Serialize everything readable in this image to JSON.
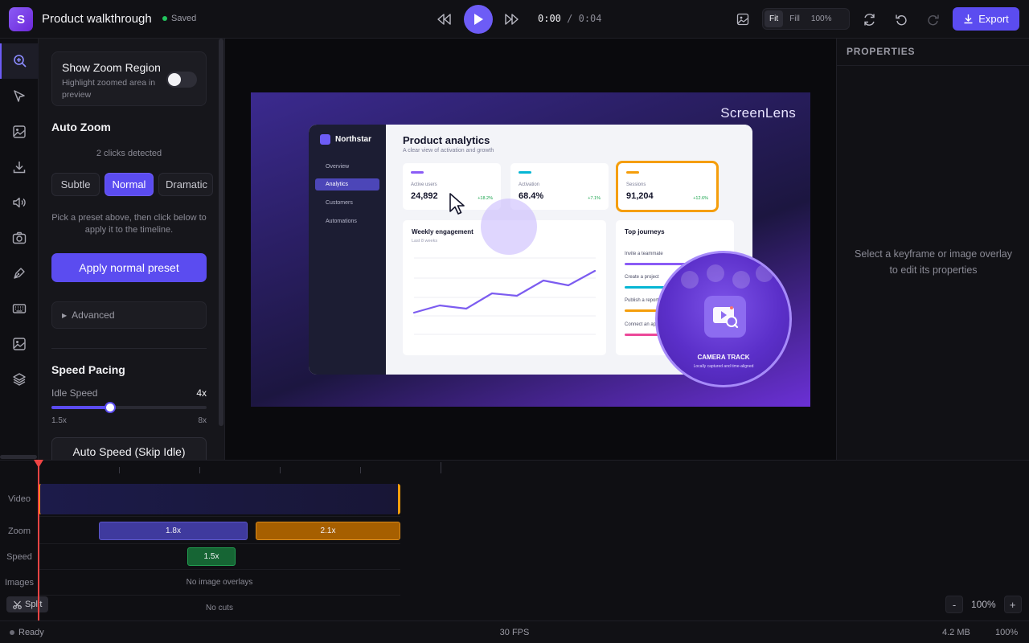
{
  "app": {
    "logo_letter": "S",
    "title": "Product walkthrough",
    "saved": "Saved"
  },
  "transport": {
    "current_time": "0:00",
    "separator": " / ",
    "duration": "0:04"
  },
  "fit_mode": {
    "options": [
      "Fit",
      "Fill",
      "100%"
    ],
    "selected": "Fit"
  },
  "toolbar": {
    "export_label": "Export",
    "accent": "#5b4cf0"
  },
  "rail": {
    "items": [
      "zoom-icon",
      "cursor-icon",
      "image-icon",
      "download-icon",
      "audio-icon",
      "camera-icon",
      "pen-icon",
      "keyboard-icon",
      "image-overlay-icon",
      "layers-icon"
    ],
    "active": "zoom-icon"
  },
  "panel": {
    "zoom_region": {
      "title": "Show Zoom Region",
      "subtitle": "Highlight zoomed area in preview",
      "enabled": false
    },
    "auto_zoom": {
      "heading": "Auto Zoom",
      "clicks": "2 clicks detected",
      "presets": [
        "Subtle",
        "Normal",
        "Dramatic"
      ],
      "selected": "Normal",
      "hint": "Pick a preset above, then click below to apply it to the timeline.",
      "apply_label": "Apply normal preset",
      "advanced_label": "Advanced"
    },
    "speed": {
      "heading": "Speed Pacing",
      "idle_label": "Idle Speed",
      "idle_value": "4x",
      "min": "1.5x",
      "max": "8x",
      "slider_fraction": 0.38,
      "auto_label": "Auto Speed (Skip Idle)"
    }
  },
  "preview": {
    "brand": "ScreenLens",
    "app": {
      "name": "Northstar",
      "nav": [
        "Overview",
        "Analytics",
        "Customers",
        "Automations"
      ],
      "nav_active": "Analytics",
      "title": "Product analytics",
      "subtitle": "A clear view of activation and growth",
      "kpis": [
        {
          "label": "Active users",
          "value": "24,892",
          "delta": "+18.2%",
          "color": "#8b5cf6"
        },
        {
          "label": "Activation",
          "value": "68.4%",
          "delta": "+7.1%",
          "color": "#06b6d4"
        },
        {
          "label": "Sessions",
          "value": "91,204",
          "delta": "+12.6%",
          "color": "#f59e0b"
        }
      ],
      "engagement": {
        "title": "Weekly engagement",
        "subtitle": "Last 8 weeks"
      },
      "journeys": {
        "title": "Top journeys",
        "items": [
          {
            "label": "Invite a teammate",
            "color": "#8b5cf6"
          },
          {
            "label": "Create a project",
            "color": "#06b6d4"
          },
          {
            "label": "Publish a report",
            "color": "#f59e0b"
          },
          {
            "label": "Connect an app",
            "color": "#ec4899"
          }
        ]
      }
    },
    "camera": {
      "title": "CAMERA TRACK",
      "subtitle": "Locally captured and time-aligned"
    }
  },
  "properties": {
    "heading": "PROPERTIES",
    "empty": "Select a keyframe or image overlay to edit its properties"
  },
  "timeline": {
    "tracks": [
      "Video",
      "Zoom",
      "Speed",
      "Images",
      "Cuts"
    ],
    "zoom_clips": [
      {
        "label": "1.8x",
        "color": "#3f3a9e"
      },
      {
        "label": "2.1x",
        "color": "#a65f00"
      }
    ],
    "speed_clips": [
      {
        "label": "1.5x",
        "color": "#166534"
      }
    ],
    "images_empty": "No image overlays",
    "cuts_empty": "No cuts",
    "split_label": "Split",
    "zoom_level": "100%",
    "minus": "-",
    "plus": "+"
  },
  "status": {
    "state": "Ready",
    "fps": "30 FPS",
    "size": "4.2 MB",
    "zoom": "100%"
  }
}
